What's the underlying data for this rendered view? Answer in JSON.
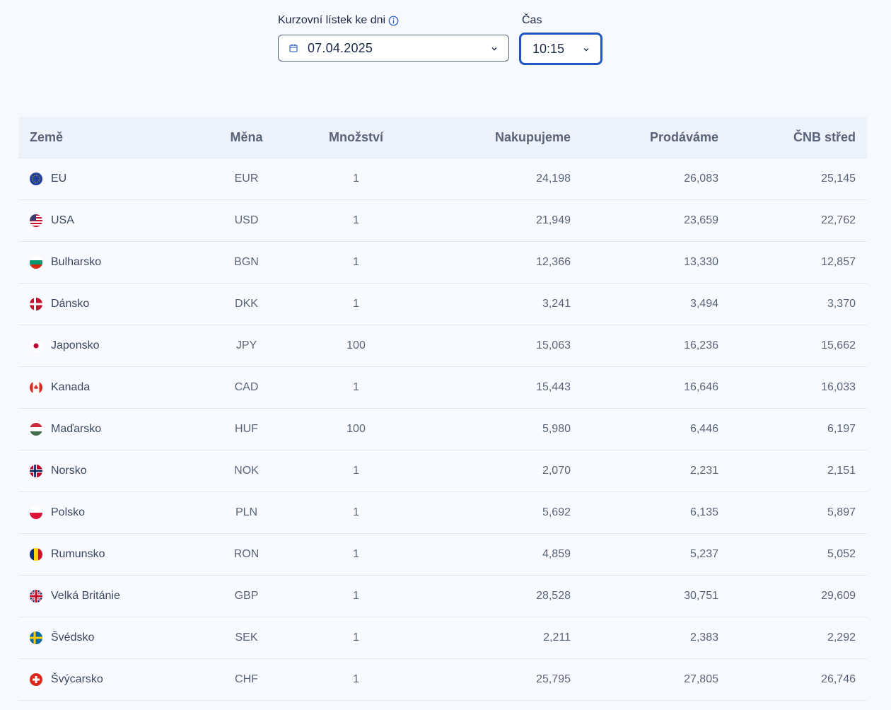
{
  "filters": {
    "date_label": "Kurzovní lístek ke dni",
    "date_value": "07.04.2025",
    "time_label": "Čas",
    "time_value": "10:15"
  },
  "table": {
    "headers": {
      "country": "Země",
      "currency": "Měna",
      "quantity": "Množství",
      "buy": "Nakupujeme",
      "sell": "Prodáváme",
      "mid": "ČNB střed"
    },
    "rows": [
      {
        "country": "EU",
        "flag": "eu-flag-icon",
        "currency": "EUR",
        "quantity": "1",
        "buy": "24,198",
        "sell": "26,083",
        "mid": "25,145"
      },
      {
        "country": "USA",
        "flag": "us-flag-icon",
        "currency": "USD",
        "quantity": "1",
        "buy": "21,949",
        "sell": "23,659",
        "mid": "22,762"
      },
      {
        "country": "Bulharsko",
        "flag": "bg-flag-icon",
        "currency": "BGN",
        "quantity": "1",
        "buy": "12,366",
        "sell": "13,330",
        "mid": "12,857"
      },
      {
        "country": "Dánsko",
        "flag": "dk-flag-icon",
        "currency": "DKK",
        "quantity": "1",
        "buy": "3,241",
        "sell": "3,494",
        "mid": "3,370"
      },
      {
        "country": "Japonsko",
        "flag": "jp-flag-icon",
        "currency": "JPY",
        "quantity": "100",
        "buy": "15,063",
        "sell": "16,236",
        "mid": "15,662"
      },
      {
        "country": "Kanada",
        "flag": "ca-flag-icon",
        "currency": "CAD",
        "quantity": "1",
        "buy": "15,443",
        "sell": "16,646",
        "mid": "16,033"
      },
      {
        "country": "Maďarsko",
        "flag": "hu-flag-icon",
        "currency": "HUF",
        "quantity": "100",
        "buy": "5,980",
        "sell": "6,446",
        "mid": "6,197"
      },
      {
        "country": "Norsko",
        "flag": "no-flag-icon",
        "currency": "NOK",
        "quantity": "1",
        "buy": "2,070",
        "sell": "2,231",
        "mid": "2,151"
      },
      {
        "country": "Polsko",
        "flag": "pl-flag-icon",
        "currency": "PLN",
        "quantity": "1",
        "buy": "5,692",
        "sell": "6,135",
        "mid": "5,897"
      },
      {
        "country": "Rumunsko",
        "flag": "ro-flag-icon",
        "currency": "RON",
        "quantity": "1",
        "buy": "4,859",
        "sell": "5,237",
        "mid": "5,052"
      },
      {
        "country": "Velká Británie",
        "flag": "gb-flag-icon",
        "currency": "GBP",
        "quantity": "1",
        "buy": "28,528",
        "sell": "30,751",
        "mid": "29,609"
      },
      {
        "country": "Švédsko",
        "flag": "se-flag-icon",
        "currency": "SEK",
        "quantity": "1",
        "buy": "2,211",
        "sell": "2,383",
        "mid": "2,292"
      },
      {
        "country": "Švýcarsko",
        "flag": "ch-flag-icon",
        "currency": "CHF",
        "quantity": "1",
        "buy": "25,795",
        "sell": "27,805",
        "mid": "26,746"
      }
    ]
  },
  "colors": {
    "accent": "#1f56c3",
    "header_bg": "#eef2fb",
    "page_bg": "#f7f9fe",
    "text_muted": "#5a6478"
  }
}
